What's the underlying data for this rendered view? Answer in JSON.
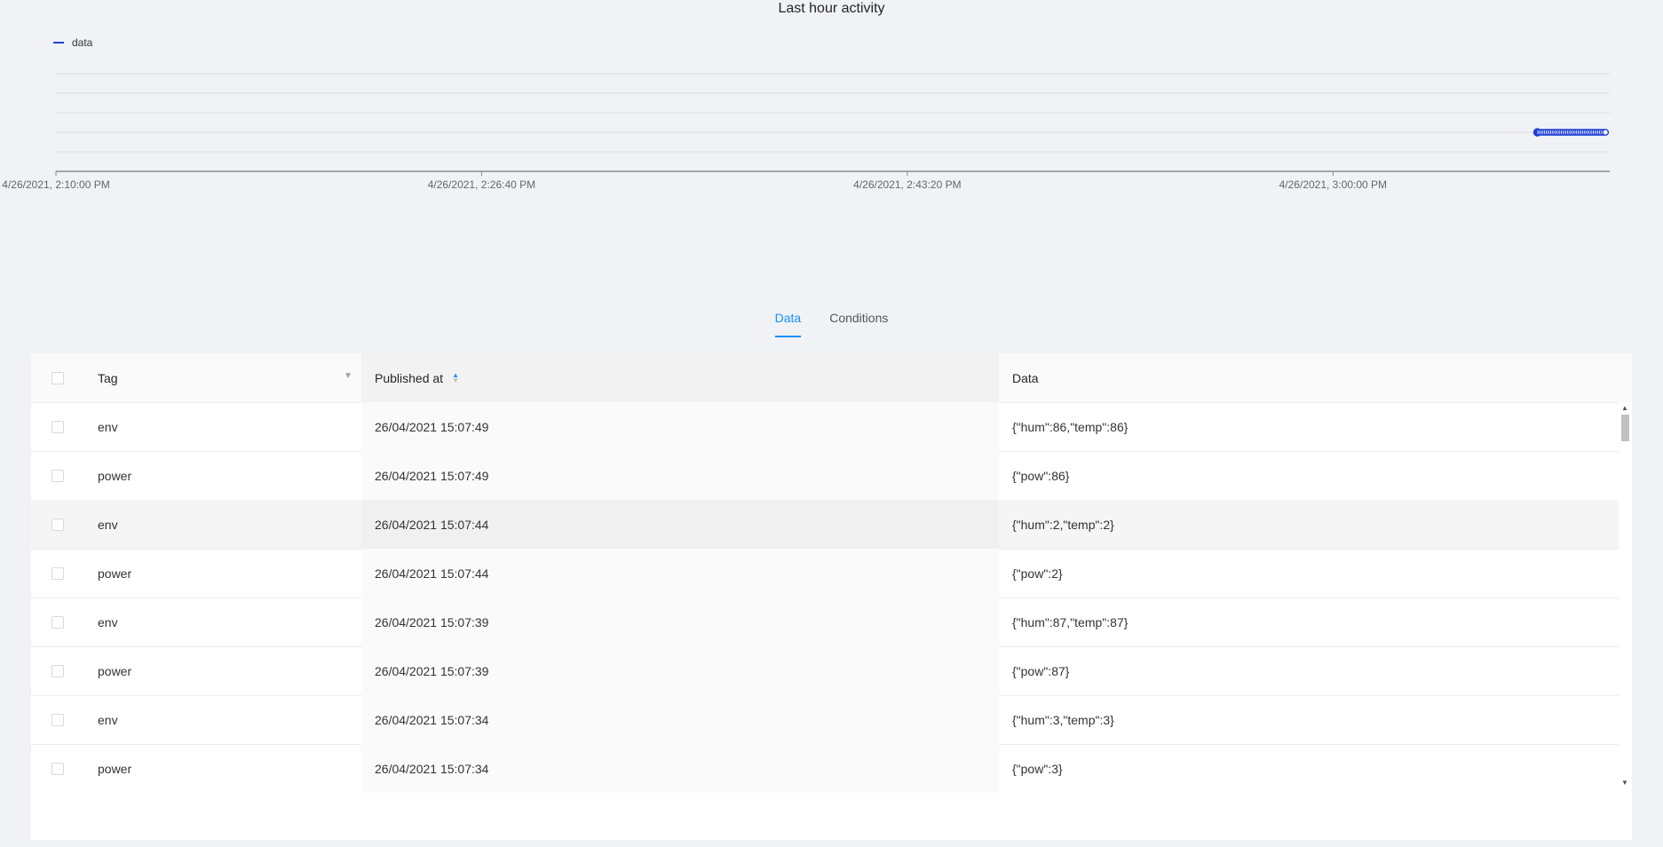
{
  "chart": {
    "title": "Last hour activity",
    "legend": "data"
  },
  "chart_data": {
    "type": "line",
    "title": "Last hour activity",
    "series": [
      {
        "name": "data",
        "color": "#1f3fd6"
      }
    ],
    "x_tick_labels": [
      "4/26/2021, 2:10:00 PM",
      "4/26/2021, 2:26:40 PM",
      "4/26/2021, 2:43:20 PM",
      "4/26/2021, 3:00:00 PM"
    ],
    "xlim_seconds_after_2pm": [
      600,
      4250
    ],
    "tick_seconds_after_2pm": [
      600,
      1600,
      2600,
      3600
    ],
    "points_seconds_after_2pm": [
      4080,
      4085,
      4090,
      4095,
      4100,
      4105,
      4110,
      4115,
      4120,
      4125,
      4130,
      4135,
      4140,
      4145,
      4150,
      4155,
      4160,
      4165,
      4170,
      4175,
      4180,
      4185,
      4190,
      4195,
      4200,
      4205,
      4210,
      4215,
      4220,
      4225,
      4230,
      4235,
      4240
    ],
    "ylim": [
      0,
      5
    ],
    "y_point_value": 2,
    "grid": true,
    "legend_position": "top-left"
  },
  "tabs": [
    {
      "label": "Data",
      "active": true
    },
    {
      "label": "Conditions",
      "active": false
    }
  ],
  "table": {
    "columns": {
      "tag": "Tag",
      "published": "Published at",
      "data": "Data"
    },
    "rows": [
      {
        "tag": "env",
        "published": "26/04/2021 15:07:49",
        "data": "{\"hum\":86,\"temp\":86}"
      },
      {
        "tag": "power",
        "published": "26/04/2021 15:07:49",
        "data": "{\"pow\":86}"
      },
      {
        "tag": "env",
        "published": "26/04/2021 15:07:44",
        "data": "{\"hum\":2,\"temp\":2}"
      },
      {
        "tag": "power",
        "published": "26/04/2021 15:07:44",
        "data": "{\"pow\":2}"
      },
      {
        "tag": "env",
        "published": "26/04/2021 15:07:39",
        "data": "{\"hum\":87,\"temp\":87}"
      },
      {
        "tag": "power",
        "published": "26/04/2021 15:07:39",
        "data": "{\"pow\":87}"
      },
      {
        "tag": "env",
        "published": "26/04/2021 15:07:34",
        "data": "{\"hum\":3,\"temp\":3}"
      },
      {
        "tag": "power",
        "published": "26/04/2021 15:07:34",
        "data": "{\"pow\":3}"
      }
    ]
  },
  "icons": {
    "filter": "filter-icon",
    "sort": "sort-icon",
    "legend_swatch": "legend-line"
  },
  "colors": {
    "accent": "#1890ff",
    "series": "#1f3fd6"
  }
}
